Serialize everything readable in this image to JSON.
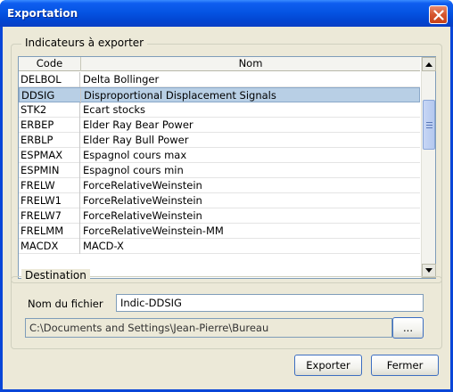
{
  "window": {
    "title": "Exportation"
  },
  "indicators": {
    "legend": "Indicateurs à exporter",
    "columns": [
      "Code",
      "Nom"
    ],
    "rows": [
      {
        "code": "DELBOL",
        "nom": "Delta Bollinger",
        "selected": false
      },
      {
        "code": "DDSIG",
        "nom": "Disproportional Displacement Signals",
        "selected": true
      },
      {
        "code": "STK2",
        "nom": "Ecart stocks",
        "selected": false
      },
      {
        "code": "ERBEP",
        "nom": "Elder Ray Bear Power",
        "selected": false
      },
      {
        "code": "ERBLP",
        "nom": "Elder Ray Bull Power",
        "selected": false
      },
      {
        "code": "ESPMAX",
        "nom": "Espagnol cours max",
        "selected": false
      },
      {
        "code": "ESPMIN",
        "nom": "Espagnol cours min",
        "selected": false
      },
      {
        "code": "FRELW",
        "nom": "ForceRelativeWeinstein",
        "selected": false
      },
      {
        "code": "FRELW1",
        "nom": "ForceRelativeWeinstein",
        "selected": false
      },
      {
        "code": "FRELW7",
        "nom": "ForceRelativeWeinstein",
        "selected": false
      },
      {
        "code": "FRELMM",
        "nom": "ForceRelativeWeinstein-MM",
        "selected": false
      },
      {
        "code": "MACDX",
        "nom": "MACD-X",
        "selected": false
      }
    ]
  },
  "destination": {
    "legend": "Destination",
    "filename_label": "Nom du fichier",
    "filename_value": "Indic-DDSIG",
    "path_value": "C:\\Documents and Settings\\Jean-Pierre\\Bureau",
    "browse_label": "..."
  },
  "buttons": {
    "export_label": "Exporter",
    "close_label": "Fermer"
  },
  "colors": {
    "titlebar": "#0554e3",
    "selection": "#b8cfe5",
    "dialog_bg": "#ece9d8"
  }
}
